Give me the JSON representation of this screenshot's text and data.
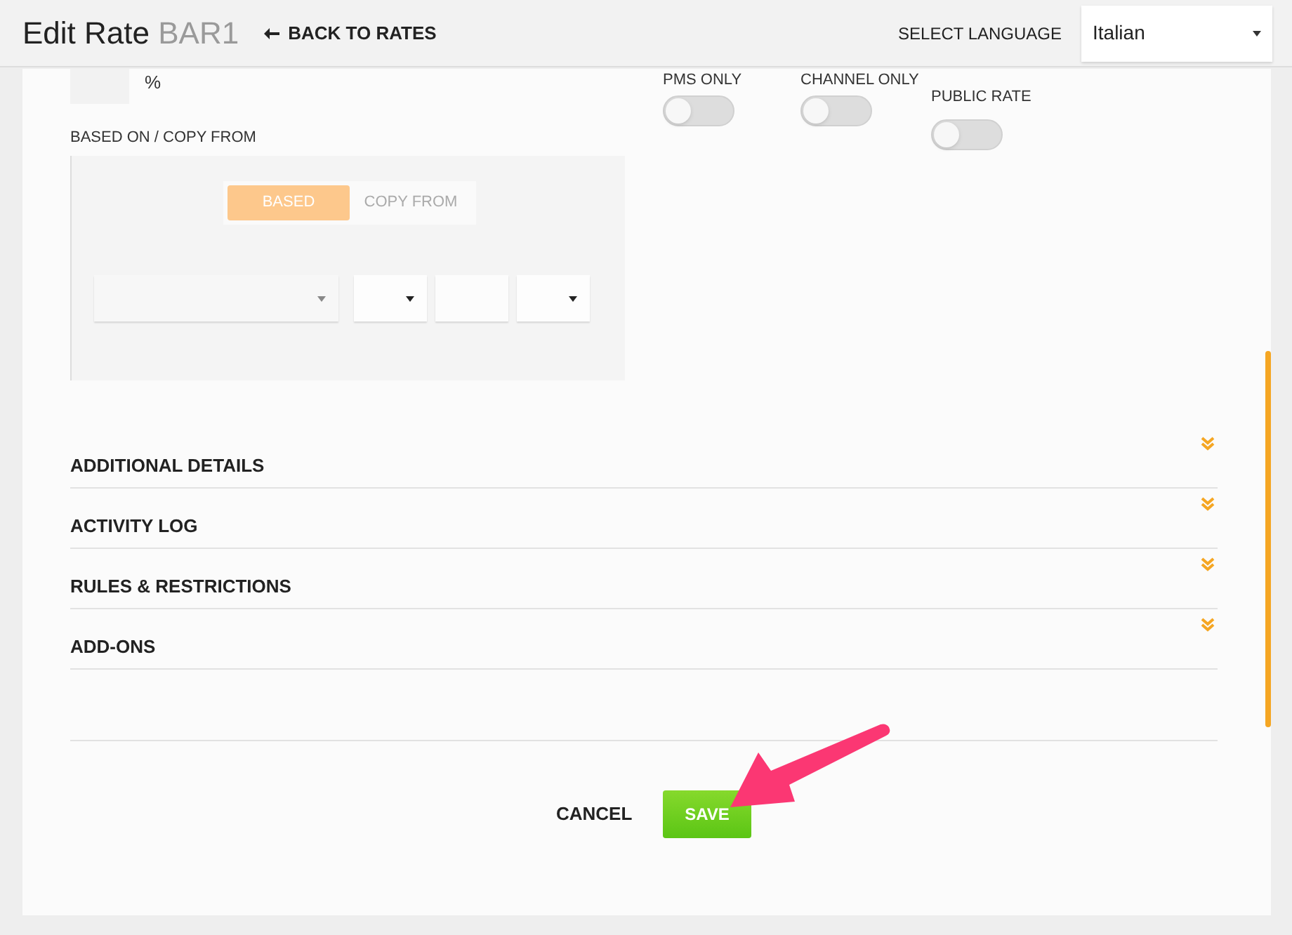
{
  "header": {
    "title": "Edit Rate",
    "code": "BAR1",
    "back_link": "BACK TO RATES",
    "language_label": "SELECT LANGUAGE",
    "language": "Italian"
  },
  "percent_unit": "%",
  "toggles": [
    {
      "label": "PMS ONLY",
      "on": false
    },
    {
      "label": "CHANNEL ONLY",
      "on": false
    },
    {
      "label": "PUBLIC RATE",
      "on": false
    }
  ],
  "based_on": {
    "label": "BASED ON / COPY FROM",
    "modes": [
      {
        "label": "BASED",
        "selected": true
      },
      {
        "label": "COPY FROM",
        "selected": false
      }
    ]
  },
  "sections": [
    {
      "title": "ADDITIONAL DETAILS",
      "expanded": false
    },
    {
      "title": "ACTIVITY LOG",
      "expanded": false
    },
    {
      "title": "RULES & RESTRICTIONS",
      "expanded": false
    },
    {
      "title": "ADD-ONS",
      "expanded": false
    }
  ],
  "actions": {
    "cancel": "CANCEL",
    "save": "SAVE"
  }
}
